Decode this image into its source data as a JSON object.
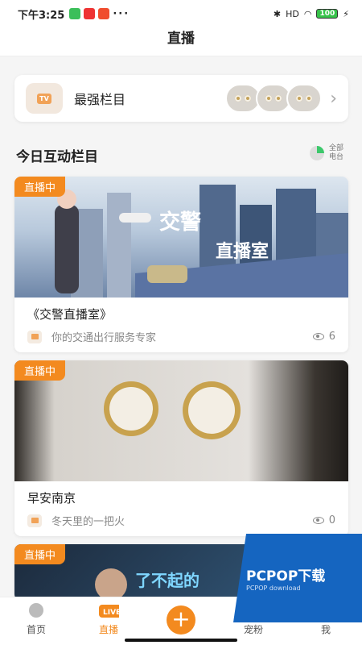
{
  "status": {
    "time": "下午3:25",
    "battery": "100",
    "network": "HD"
  },
  "nav": {
    "title": "直播"
  },
  "feature": {
    "title": "最强栏目",
    "icon": "tv-icon"
  },
  "section": {
    "title": "今日互动栏目",
    "all_label": "全部电台"
  },
  "cards": [
    {
      "tag": "直播中",
      "title": "《交警直播室》",
      "desc": "你的交通出行服务专家",
      "views": "6"
    },
    {
      "tag": "直播中",
      "title": "早安南京",
      "desc": "冬天里的一把火",
      "views": "0"
    },
    {
      "tag": "直播中"
    }
  ],
  "tabs": [
    {
      "label": "首页",
      "icon": "home-icon"
    },
    {
      "label": "直播",
      "icon": "live-icon"
    },
    {
      "label": "",
      "icon": "plus-icon"
    },
    {
      "label": "宠粉",
      "icon": "fans-icon"
    },
    {
      "label": "我",
      "icon": "profile-icon"
    }
  ],
  "watermark": {
    "text": "PCPOP下载",
    "sub": "PCPOP download"
  },
  "colors": {
    "accent": "#f38a1f"
  }
}
